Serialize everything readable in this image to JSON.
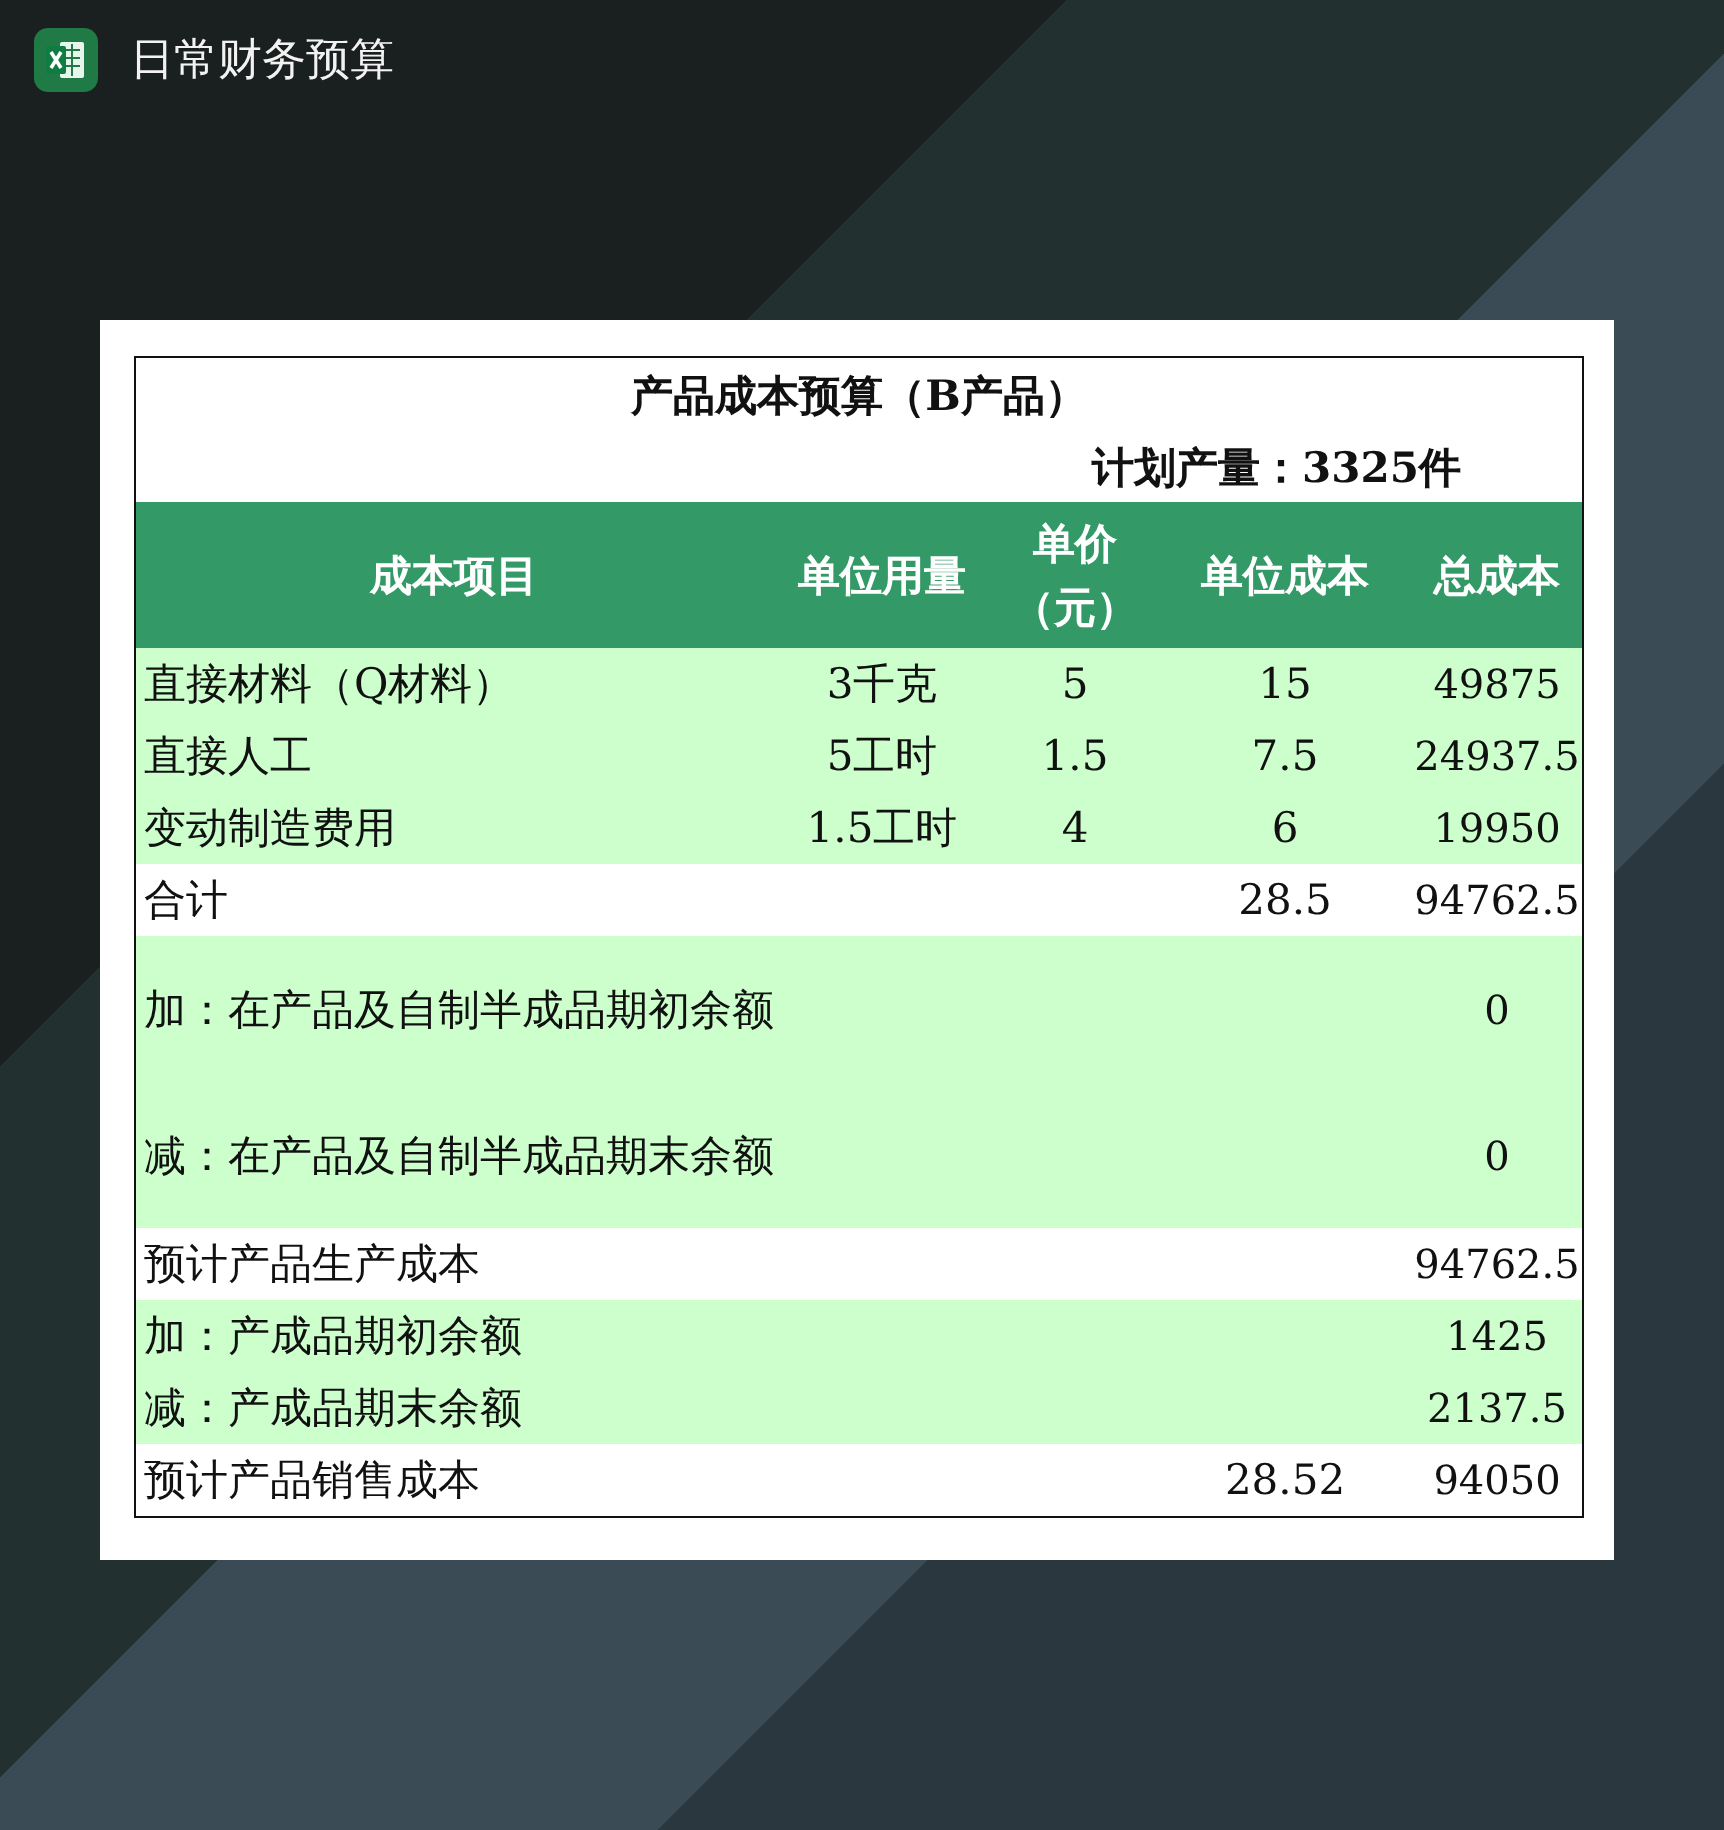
{
  "app_title": "日常财务预算",
  "sheet": {
    "title": "产品成本预算（B产品）",
    "plan": "计划产量：3325件",
    "columns": [
      "成本项目",
      "单位用量",
      "单价（元）",
      "单位成本",
      "总成本"
    ],
    "rows": [
      {
        "item": "直接材料（Q材料）",
        "usage": "3千克",
        "price": "5",
        "unit_cost": "15",
        "total": "49875",
        "shaded": true,
        "tall": false
      },
      {
        "item": "直接人工",
        "usage": "5工时",
        "price": "1.5",
        "unit_cost": "7.5",
        "total": "24937.5",
        "shaded": true,
        "tall": false
      },
      {
        "item": "变动制造费用",
        "usage": "1.5工时",
        "price": "4",
        "unit_cost": "6",
        "total": "19950",
        "shaded": true,
        "tall": false
      },
      {
        "item": "合计",
        "unit_cost": "28.5",
        "total": "94762.5",
        "shaded": false,
        "tall": false
      },
      {
        "item": "加：在产品及自制半成品期初余额",
        "total": "0",
        "shaded": true,
        "tall": true
      },
      {
        "item": "减：在产品及自制半成品期末余额",
        "total": "0",
        "shaded": true,
        "tall": true
      },
      {
        "item": "预计产品生产成本",
        "total": "94762.5",
        "shaded": false,
        "tall": false
      },
      {
        "item": "加：产成品期初余额",
        "total": "1425",
        "shaded": true,
        "tall": false
      },
      {
        "item": "减：产成品期末余额",
        "total": "2137.5",
        "shaded": true,
        "tall": false
      },
      {
        "item": "预计产品销售成本",
        "unit_cost": "28.52",
        "total": "94050",
        "shaded": false,
        "tall": false
      }
    ]
  }
}
